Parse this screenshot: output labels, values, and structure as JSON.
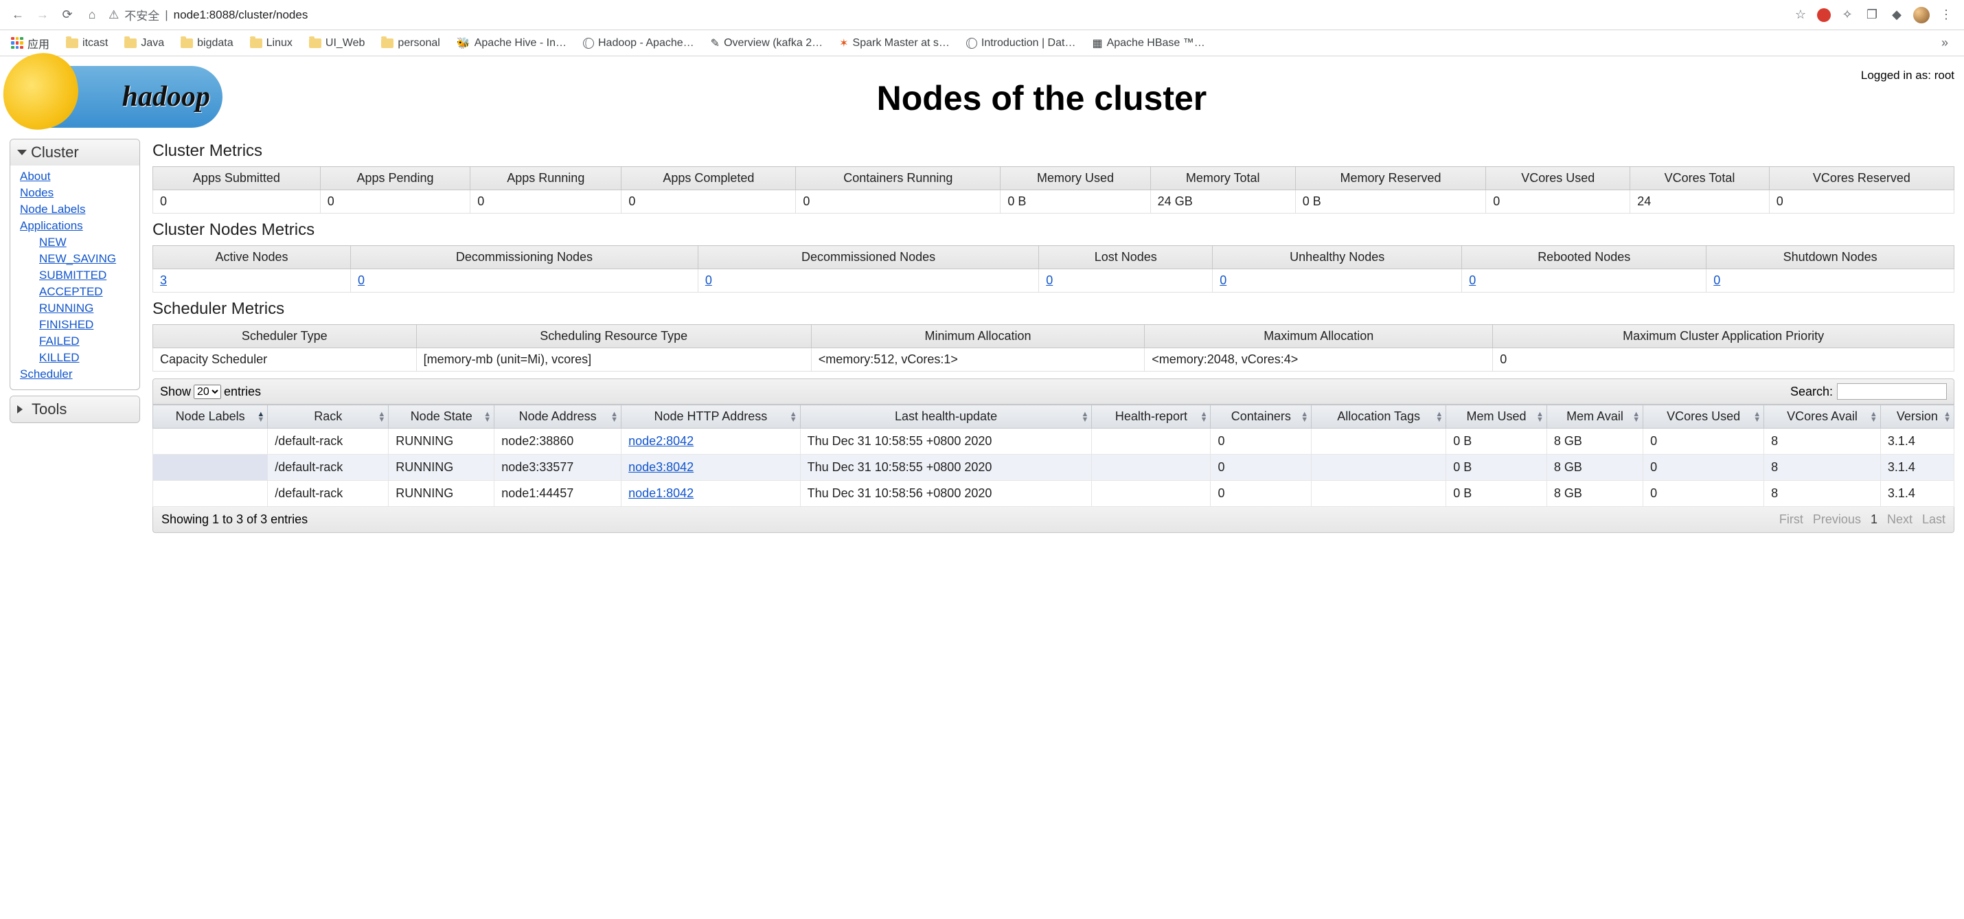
{
  "browser": {
    "insecure_label": "不安全",
    "url": "node1:8088/cluster/nodes",
    "apps_label": "应用",
    "bookmarks": [
      "itcast",
      "Java",
      "bigdata",
      "Linux",
      "UI_Web",
      "personal",
      "Apache Hive - In…",
      "Hadoop - Apache…",
      "Overview (kafka 2…",
      "Spark Master at s…",
      "Introduction | Dat…",
      "Apache HBase ™…"
    ]
  },
  "page": {
    "logo_text": "hadoop",
    "title": "Nodes of the cluster",
    "login_prefix": "Logged in as: ",
    "login_user": "root"
  },
  "sidebar": {
    "cluster_label": "Cluster",
    "tools_label": "Tools",
    "links": {
      "about": "About",
      "nodes": "Nodes",
      "node_labels": "Node Labels",
      "applications": "Applications",
      "new": "NEW",
      "new_saving": "NEW_SAVING",
      "submitted": "SUBMITTED",
      "accepted": "ACCEPTED",
      "running": "RUNNING",
      "finished": "FINISHED",
      "failed": "FAILED",
      "killed": "KILLED",
      "scheduler": "Scheduler"
    }
  },
  "cluster_metrics": {
    "title": "Cluster Metrics",
    "headers": [
      "Apps Submitted",
      "Apps Pending",
      "Apps Running",
      "Apps Completed",
      "Containers Running",
      "Memory Used",
      "Memory Total",
      "Memory Reserved",
      "VCores Used",
      "VCores Total",
      "VCores Reserved"
    ],
    "values": [
      "0",
      "0",
      "0",
      "0",
      "0",
      "0 B",
      "24 GB",
      "0 B",
      "0",
      "24",
      "0"
    ]
  },
  "cluster_nodes_metrics": {
    "title": "Cluster Nodes Metrics",
    "headers": [
      "Active Nodes",
      "Decommissioning Nodes",
      "Decommissioned Nodes",
      "Lost Nodes",
      "Unhealthy Nodes",
      "Rebooted Nodes",
      "Shutdown Nodes"
    ],
    "values": [
      "3",
      "0",
      "0",
      "0",
      "0",
      "0",
      "0"
    ]
  },
  "scheduler_metrics": {
    "title": "Scheduler Metrics",
    "headers": [
      "Scheduler Type",
      "Scheduling Resource Type",
      "Minimum Allocation",
      "Maximum Allocation",
      "Maximum Cluster Application Priority"
    ],
    "values": [
      "Capacity Scheduler",
      "[memory-mb (unit=Mi), vcores]",
      "<memory:512, vCores:1>",
      "<memory:2048, vCores:4>",
      "0"
    ]
  },
  "dt": {
    "show_label": "Show",
    "entries_label": "entries",
    "page_size": "20",
    "search_label": "Search:",
    "search_value": "",
    "info": "Showing 1 to 3 of 3 entries",
    "pager": {
      "first": "First",
      "previous": "Previous",
      "p1": "1",
      "next": "Next",
      "last": "Last"
    }
  },
  "nodes_table": {
    "headers": [
      "Node Labels",
      "Rack",
      "Node State",
      "Node Address",
      "Node HTTP Address",
      "Last health-update",
      "Health-report",
      "Containers",
      "Allocation Tags",
      "Mem Used",
      "Mem Avail",
      "VCores Used",
      "VCores Avail",
      "Version"
    ],
    "rows": [
      {
        "labels": "",
        "rack": "/default-rack",
        "state": "RUNNING",
        "address": "node2:38860",
        "http": "node2:8042",
        "last_health": "Thu Dec 31 10:58:55 +0800 2020",
        "health_report": "",
        "containers": "0",
        "alloc_tags": "",
        "mem_used": "0 B",
        "mem_avail": "8 GB",
        "vcores_used": "0",
        "vcores_avail": "8",
        "version": "3.1.4"
      },
      {
        "labels": "",
        "rack": "/default-rack",
        "state": "RUNNING",
        "address": "node3:33577",
        "http": "node3:8042",
        "last_health": "Thu Dec 31 10:58:55 +0800 2020",
        "health_report": "",
        "containers": "0",
        "alloc_tags": "",
        "mem_used": "0 B",
        "mem_avail": "8 GB",
        "vcores_used": "0",
        "vcores_avail": "8",
        "version": "3.1.4"
      },
      {
        "labels": "",
        "rack": "/default-rack",
        "state": "RUNNING",
        "address": "node1:44457",
        "http": "node1:8042",
        "last_health": "Thu Dec 31 10:58:56 +0800 2020",
        "health_report": "",
        "containers": "0",
        "alloc_tags": "",
        "mem_used": "0 B",
        "mem_avail": "8 GB",
        "vcores_used": "0",
        "vcores_avail": "8",
        "version": "3.1.4"
      }
    ]
  }
}
